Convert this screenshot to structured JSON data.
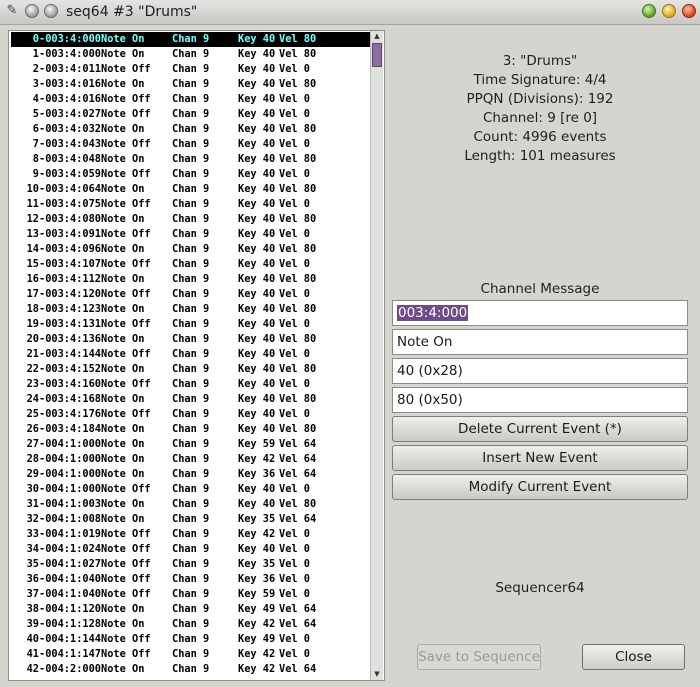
{
  "window": {
    "title": "seq64 #3 \"Drums\"",
    "app_icon": "pencil-icon"
  },
  "events": [
    {
      "idx": "0-003:4:000",
      "type": "Note On",
      "chan": "Chan 9",
      "key": "Key 40",
      "vel": "Vel 80"
    },
    {
      "idx": "1-003:4:000",
      "type": "Note On",
      "chan": "Chan 9",
      "key": "Key 40",
      "vel": "Vel 80"
    },
    {
      "idx": "2-003:4:011",
      "type": "Note Off",
      "chan": "Chan 9",
      "key": "Key 40",
      "vel": "Vel 0"
    },
    {
      "idx": "3-003:4:016",
      "type": "Note On",
      "chan": "Chan 9",
      "key": "Key 40",
      "vel": "Vel 80"
    },
    {
      "idx": "4-003:4:016",
      "type": "Note Off",
      "chan": "Chan 9",
      "key": "Key 40",
      "vel": "Vel 0"
    },
    {
      "idx": "5-003:4:027",
      "type": "Note Off",
      "chan": "Chan 9",
      "key": "Key 40",
      "vel": "Vel 0"
    },
    {
      "idx": "6-003:4:032",
      "type": "Note On",
      "chan": "Chan 9",
      "key": "Key 40",
      "vel": "Vel 80"
    },
    {
      "idx": "7-003:4:043",
      "type": "Note Off",
      "chan": "Chan 9",
      "key": "Key 40",
      "vel": "Vel 0"
    },
    {
      "idx": "8-003:4:048",
      "type": "Note On",
      "chan": "Chan 9",
      "key": "Key 40",
      "vel": "Vel 80"
    },
    {
      "idx": "9-003:4:059",
      "type": "Note Off",
      "chan": "Chan 9",
      "key": "Key 40",
      "vel": "Vel 0"
    },
    {
      "idx": "10-003:4:064",
      "type": "Note On",
      "chan": "Chan 9",
      "key": "Key 40",
      "vel": "Vel 80"
    },
    {
      "idx": "11-003:4:075",
      "type": "Note Off",
      "chan": "Chan 9",
      "key": "Key 40",
      "vel": "Vel 0"
    },
    {
      "idx": "12-003:4:080",
      "type": "Note On",
      "chan": "Chan 9",
      "key": "Key 40",
      "vel": "Vel 80"
    },
    {
      "idx": "13-003:4:091",
      "type": "Note Off",
      "chan": "Chan 9",
      "key": "Key 40",
      "vel": "Vel 0"
    },
    {
      "idx": "14-003:4:096",
      "type": "Note On",
      "chan": "Chan 9",
      "key": "Key 40",
      "vel": "Vel 80"
    },
    {
      "idx": "15-003:4:107",
      "type": "Note Off",
      "chan": "Chan 9",
      "key": "Key 40",
      "vel": "Vel 0"
    },
    {
      "idx": "16-003:4:112",
      "type": "Note On",
      "chan": "Chan 9",
      "key": "Key 40",
      "vel": "Vel 80"
    },
    {
      "idx": "17-003:4:120",
      "type": "Note Off",
      "chan": "Chan 9",
      "key": "Key 40",
      "vel": "Vel 0"
    },
    {
      "idx": "18-003:4:123",
      "type": "Note On",
      "chan": "Chan 9",
      "key": "Key 40",
      "vel": "Vel 80"
    },
    {
      "idx": "19-003:4:131",
      "type": "Note Off",
      "chan": "Chan 9",
      "key": "Key 40",
      "vel": "Vel 0"
    },
    {
      "idx": "20-003:4:136",
      "type": "Note On",
      "chan": "Chan 9",
      "key": "Key 40",
      "vel": "Vel 80"
    },
    {
      "idx": "21-003:4:144",
      "type": "Note Off",
      "chan": "Chan 9",
      "key": "Key 40",
      "vel": "Vel 0"
    },
    {
      "idx": "22-003:4:152",
      "type": "Note On",
      "chan": "Chan 9",
      "key": "Key 40",
      "vel": "Vel 80"
    },
    {
      "idx": "23-003:4:160",
      "type": "Note Off",
      "chan": "Chan 9",
      "key": "Key 40",
      "vel": "Vel 0"
    },
    {
      "idx": "24-003:4:168",
      "type": "Note On",
      "chan": "Chan 9",
      "key": "Key 40",
      "vel": "Vel 80"
    },
    {
      "idx": "25-003:4:176",
      "type": "Note Off",
      "chan": "Chan 9",
      "key": "Key 40",
      "vel": "Vel 0"
    },
    {
      "idx": "26-003:4:184",
      "type": "Note On",
      "chan": "Chan 9",
      "key": "Key 40",
      "vel": "Vel 80"
    },
    {
      "idx": "27-004:1:000",
      "type": "Note On",
      "chan": "Chan 9",
      "key": "Key 59",
      "vel": "Vel 64"
    },
    {
      "idx": "28-004:1:000",
      "type": "Note On",
      "chan": "Chan 9",
      "key": "Key 42",
      "vel": "Vel 64"
    },
    {
      "idx": "29-004:1:000",
      "type": "Note On",
      "chan": "Chan 9",
      "key": "Key 36",
      "vel": "Vel 64"
    },
    {
      "idx": "30-004:1:000",
      "type": "Note Off",
      "chan": "Chan 9",
      "key": "Key 40",
      "vel": "Vel 0"
    },
    {
      "idx": "31-004:1:003",
      "type": "Note On",
      "chan": "Chan 9",
      "key": "Key 40",
      "vel": "Vel 80"
    },
    {
      "idx": "32-004:1:008",
      "type": "Note On",
      "chan": "Chan 9",
      "key": "Key 35",
      "vel": "Vel 64"
    },
    {
      "idx": "33-004:1:019",
      "type": "Note Off",
      "chan": "Chan 9",
      "key": "Key 42",
      "vel": "Vel 0"
    },
    {
      "idx": "34-004:1:024",
      "type": "Note Off",
      "chan": "Chan 9",
      "key": "Key 40",
      "vel": "Vel 0"
    },
    {
      "idx": "35-004:1:027",
      "type": "Note Off",
      "chan": "Chan 9",
      "key": "Key 35",
      "vel": "Vel 0"
    },
    {
      "idx": "36-004:1:040",
      "type": "Note Off",
      "chan": "Chan 9",
      "key": "Key 36",
      "vel": "Vel 0"
    },
    {
      "idx": "37-004:1:040",
      "type": "Note Off",
      "chan": "Chan 9",
      "key": "Key 59",
      "vel": "Vel 0"
    },
    {
      "idx": "38-004:1:120",
      "type": "Note On",
      "chan": "Chan 9",
      "key": "Key 49",
      "vel": "Vel 64"
    },
    {
      "idx": "39-004:1:128",
      "type": "Note On",
      "chan": "Chan 9",
      "key": "Key 42",
      "vel": "Vel 64"
    },
    {
      "idx": "40-004:1:144",
      "type": "Note Off",
      "chan": "Chan 9",
      "key": "Key 49",
      "vel": "Vel 0"
    },
    {
      "idx": "41-004:1:147",
      "type": "Note Off",
      "chan": "Chan 9",
      "key": "Key 42",
      "vel": "Vel 0"
    },
    {
      "idx": "42-004:2:000",
      "type": "Note On",
      "chan": "Chan 9",
      "key": "Key 42",
      "vel": "Vel 64"
    }
  ],
  "selected_index": 0,
  "info": {
    "track": "3: \"Drums\"",
    "time_signature": "Time Signature: 4/4",
    "ppqn": "PPQN (Divisions): 192",
    "channel": "Channel: 9 [re 0]",
    "count": "Count: 4996 events",
    "length": "Length: 101 measures"
  },
  "editor": {
    "section_label": "Channel Message",
    "timestamp": "003:4:000",
    "event_name": "Note On",
    "data1": "40 (0x28)",
    "data2": "80 (0x50)",
    "delete_label": "Delete Current Event (*)",
    "insert_label": "Insert New Event",
    "modify_label": "Modify Current Event"
  },
  "footer": {
    "brand": "Sequencer64",
    "save_label": "Save to Sequence",
    "close_label": "Close"
  },
  "colors": {
    "selection_bg": "#000000",
    "selection_fg": "#77ffff",
    "field_selection": "#6e4c86",
    "scroll_thumb": "#8a6ea0"
  }
}
